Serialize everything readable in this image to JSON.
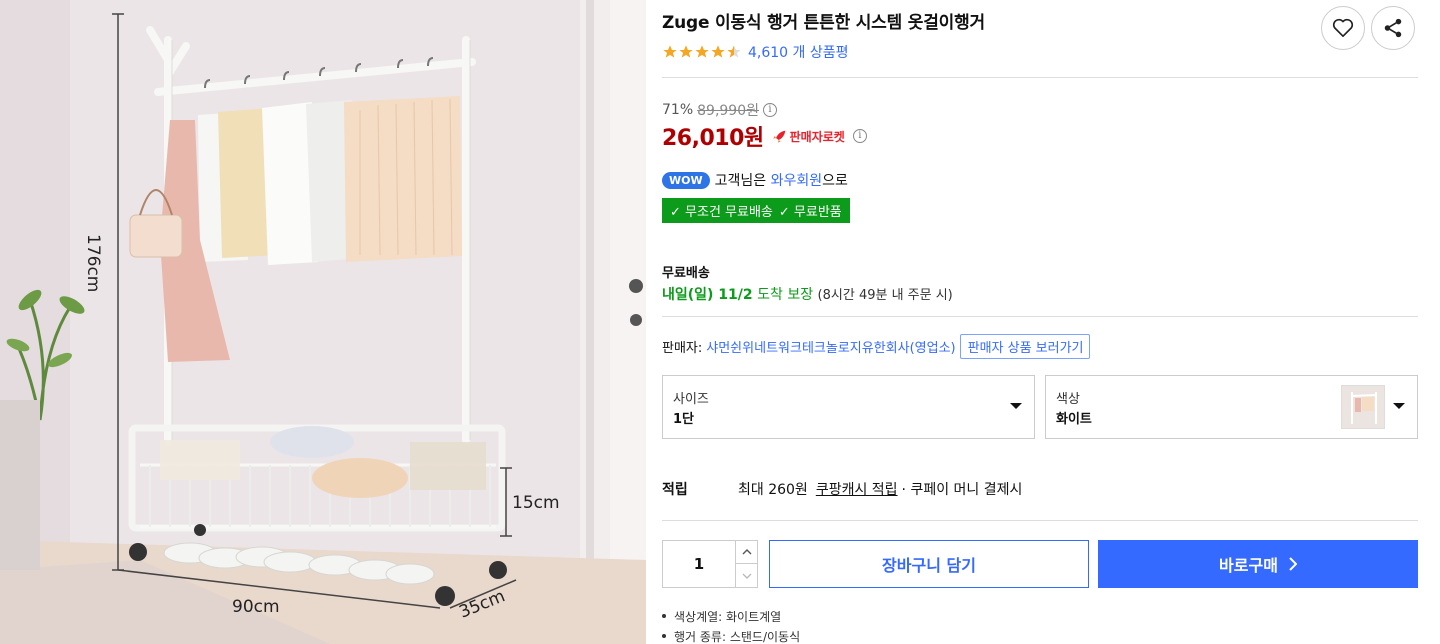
{
  "image": {
    "dimensions": {
      "height": "176cm",
      "width": "90cm",
      "depth": "35cm",
      "basket": "15cm"
    }
  },
  "product": {
    "title": "Zuge 이동식 행거 튼튼한 시스템 옷걸이행거",
    "rating": 4.5,
    "review_count": "4,610 개 상품평"
  },
  "price": {
    "discount": "71%",
    "original": "89,990원",
    "sale": "26,010원",
    "badge": "판매자로켓"
  },
  "wow": {
    "badge": "WOW",
    "prefix": "고객님은",
    "member": "와우회원",
    "suffix": "으로",
    "benefit1": "✓ 무조건 무료배송",
    "benefit2": "✓ 무료반품"
  },
  "shipping": {
    "title": "무료배송",
    "arrival_date": "내일(일) 11/2",
    "arrival_guarantee": "도착 보장",
    "cutoff": "(8시간 49분 내 주문 시)"
  },
  "seller": {
    "label": "판매자:",
    "name": "샤먼쉰위네트워크테크놀로지유한회사(영업소)",
    "link": "판매자 상품 보러가기"
  },
  "options": {
    "size_label": "사이즈",
    "size_value": "1단",
    "color_label": "색상",
    "color_value": "화이트"
  },
  "points": {
    "label": "적립",
    "amount": "최대 260원",
    "link": "쿠팡캐시 적립",
    "suffix": "· 쿠페이 머니 결제시"
  },
  "purchase": {
    "quantity": "1",
    "cart": "장바구니 담기",
    "buy": "바로구매"
  },
  "attributes": [
    "색상계열: 화이트계열",
    "행거 종류: 스탠드/이동식"
  ],
  "colors": {
    "accent": "#346aff",
    "price_red": "#ae0000",
    "green": "#0c9b1a",
    "star": "#f5a623"
  },
  "icons": [
    "heart-icon",
    "share-icon",
    "star-icon",
    "info-icon",
    "rocket-icon",
    "caret-down-icon",
    "chevron-up-icon",
    "chevron-down-icon",
    "chevron-right-icon"
  ]
}
